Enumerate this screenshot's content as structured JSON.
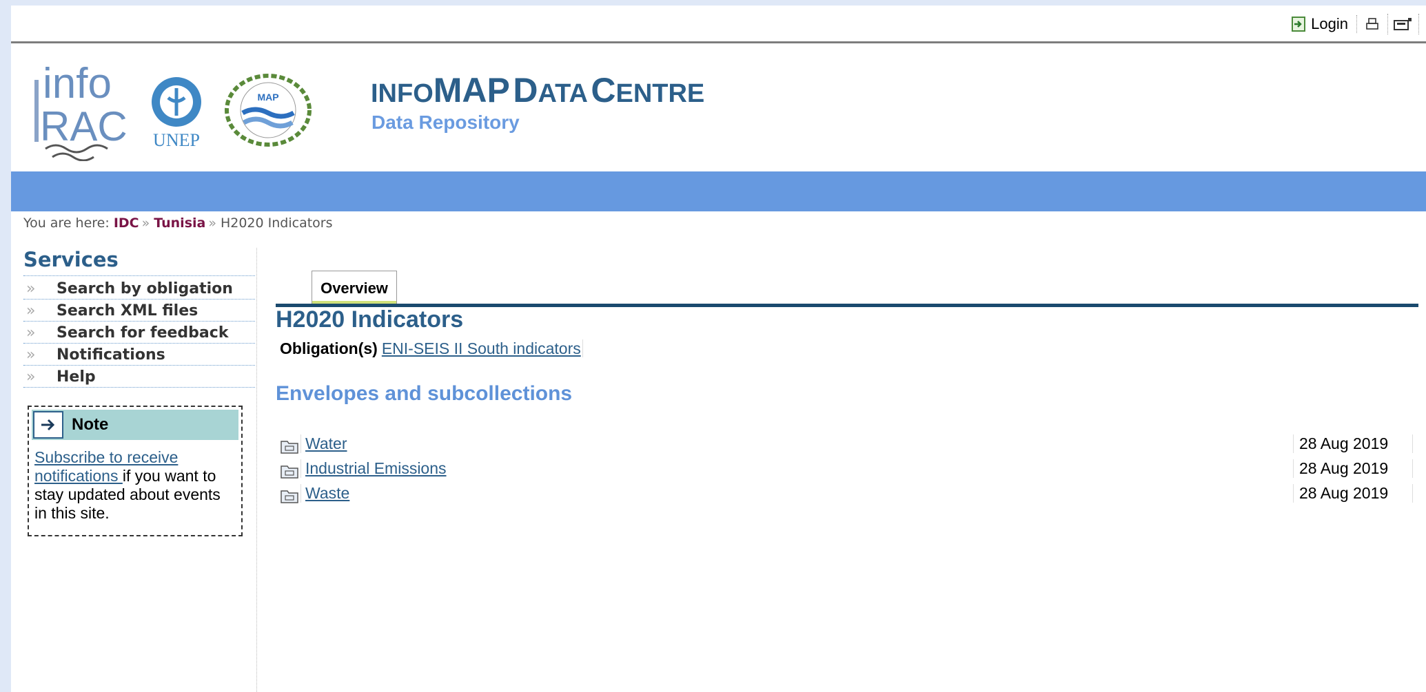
{
  "topbar": {
    "login_label": "Login",
    "login_icon": "login-icon",
    "print_icon": "print-icon",
    "fullscreen_icon": "fullscreen-icon"
  },
  "header": {
    "logo_info_line1": "info",
    "logo_info_line2": "RAC",
    "logo_unep_label": "UNEP",
    "logo_map_label": "MAP",
    "title_prefix_small": "INFO",
    "title_map": "MAP",
    "title_d": "D",
    "title_ata": "ATA",
    "title_c": "C",
    "title_entre": "ENTRE",
    "subtitle": "Data Repository"
  },
  "breadcrumb": {
    "prefix": "You are here:",
    "items": [
      {
        "label": "IDC"
      },
      {
        "label": "Tunisia"
      }
    ],
    "current": "H2020 Indicators",
    "separator": "»"
  },
  "sidebar": {
    "title": "Services",
    "items": [
      {
        "label": "Search by obligation"
      },
      {
        "label": "Search XML files"
      },
      {
        "label": "Search for feedback"
      },
      {
        "label": "Notifications"
      },
      {
        "label": "Help"
      }
    ],
    "bullet": "»",
    "note": {
      "title": "Note",
      "link_text": "Subscribe to receive notifications ",
      "rest_text": "if you want to stay updated about events in this site."
    }
  },
  "main": {
    "tab_label": "Overview",
    "title": "H2020 Indicators",
    "obligation_label": "Obligation(s)",
    "obligation_link": "ENI-SEIS II South indicators",
    "section_title": "Envelopes and subcollections",
    "rows": [
      {
        "name": "Water",
        "date": "28 Aug 2019"
      },
      {
        "name": "Industrial Emissions",
        "date": "28 Aug 2019"
      },
      {
        "name": "Waste",
        "date": "28 Aug 2019"
      }
    ]
  },
  "colors": {
    "accent_blue": "#6699e0",
    "title_blue": "#2c5f8a",
    "breadcrumb_link": "#7a1446",
    "note_bg": "#a8d4d4"
  }
}
